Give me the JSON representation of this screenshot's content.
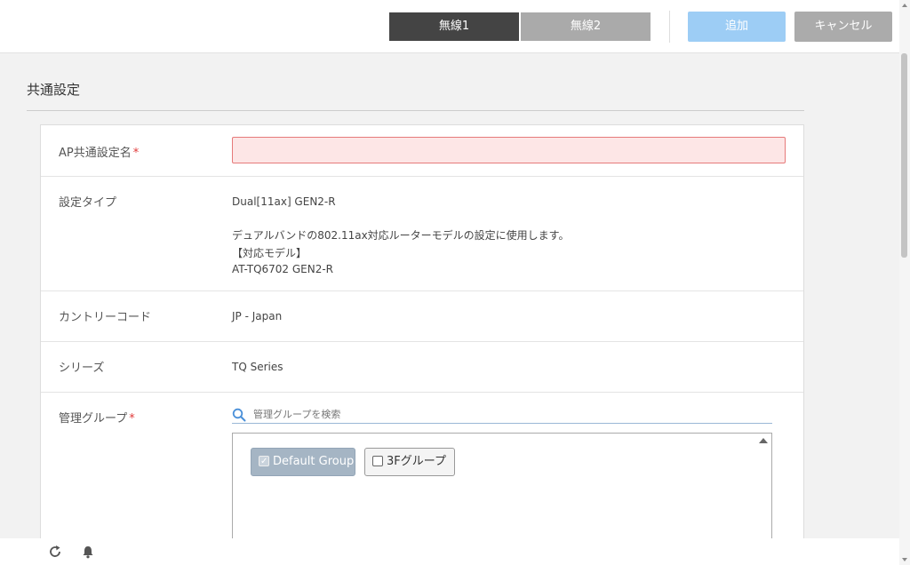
{
  "tabs": [
    {
      "label": "無線1",
      "active": true
    },
    {
      "label": "無線2",
      "active": false
    }
  ],
  "buttons": {
    "add": "追加",
    "cancel": "キャンセル"
  },
  "section_title": "共通設定",
  "rows": {
    "ap_name": {
      "label": "AP共通設定名",
      "required": "*",
      "value": ""
    },
    "config_type": {
      "label": "設定タイプ",
      "value": "Dual[11ax] GEN2-R",
      "description": "デュアルバンドの802.11ax対応ルーターモデルの設定に使用します。",
      "models_header": "【対応モデル】",
      "models": "AT-TQ6702 GEN2-R"
    },
    "country": {
      "label": "カントリーコード",
      "value": "JP - Japan"
    },
    "series": {
      "label": "シリーズ",
      "value": "TQ Series"
    },
    "group": {
      "label": "管理グループ",
      "required": "*",
      "search_placeholder": "管理グループを検索",
      "items": [
        {
          "label": "Default Group",
          "checked": true,
          "disabled": true
        },
        {
          "label": "3Fグループ",
          "checked": false,
          "disabled": false
        }
      ]
    }
  },
  "colors": {
    "accent": "#9dcdf5",
    "active_tab": "#444444",
    "required": "#e03a3a"
  },
  "footer_icons": [
    "refresh-icon",
    "bell-icon"
  ]
}
